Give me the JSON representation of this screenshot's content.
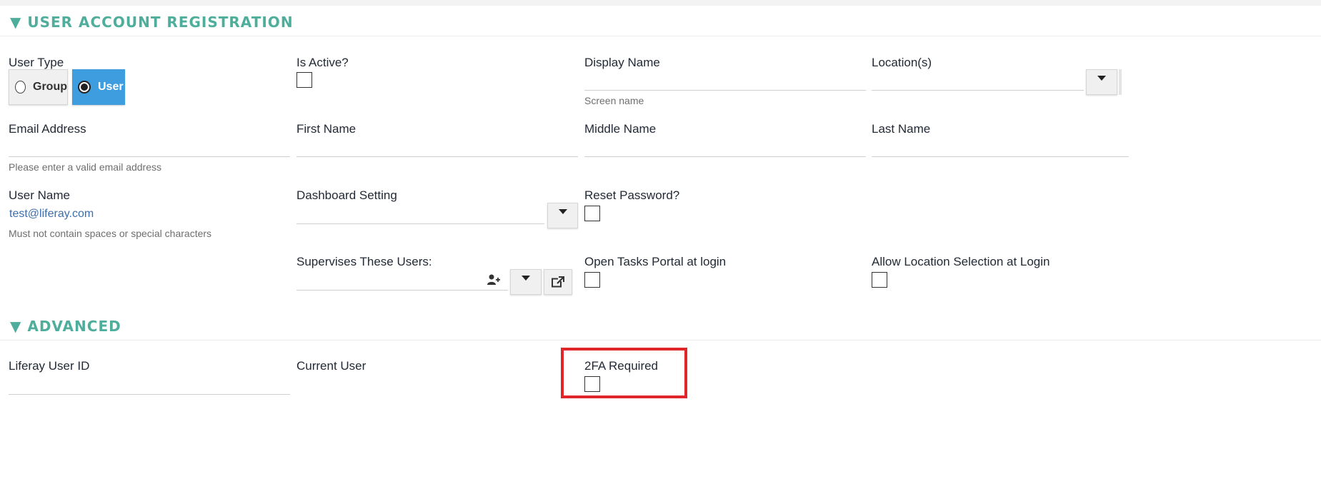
{
  "sections": {
    "registration": {
      "title": "▼ USER ACCOUNT REGISTRATION"
    },
    "advanced": {
      "title": "▼ ADVANCED"
    }
  },
  "fields": {
    "user_type": {
      "label": "User Type",
      "options": [
        "Group",
        "User"
      ],
      "selected": "User"
    },
    "is_active": {
      "label": "Is Active?"
    },
    "display_name": {
      "label": "Display Name",
      "hint": "Screen name"
    },
    "locations": {
      "label": "Location(s)"
    },
    "email": {
      "label": "Email Address",
      "hint": "Please enter a valid email address"
    },
    "first_name": {
      "label": "First Name"
    },
    "middle_name": {
      "label": "Middle Name"
    },
    "last_name": {
      "label": "Last Name"
    },
    "user_name": {
      "label": "User Name",
      "value": "test@liferay.com",
      "hint": "Must not contain spaces or special characters"
    },
    "dashboard_setting": {
      "label": "Dashboard Setting"
    },
    "reset_password": {
      "label": "Reset Password?"
    },
    "supervises": {
      "label": "Supervises These Users:"
    },
    "open_tasks": {
      "label": "Open Tasks Portal at login"
    },
    "allow_location": {
      "label": "Allow Location Selection at Login"
    },
    "liferay_user_id": {
      "label": "Liferay User ID"
    },
    "current_user": {
      "label": "Current User"
    },
    "twofa": {
      "label": "2FA Required"
    }
  },
  "colors": {
    "section_title": "#4fae9b",
    "selected_button": "#3d9ddf",
    "highlight": "#e0262b",
    "link_value": "#3d6eab"
  },
  "icons": {
    "add_user": "user-plus-icon",
    "open_external": "external-link-icon",
    "dropdown": "caret-down-icon"
  }
}
